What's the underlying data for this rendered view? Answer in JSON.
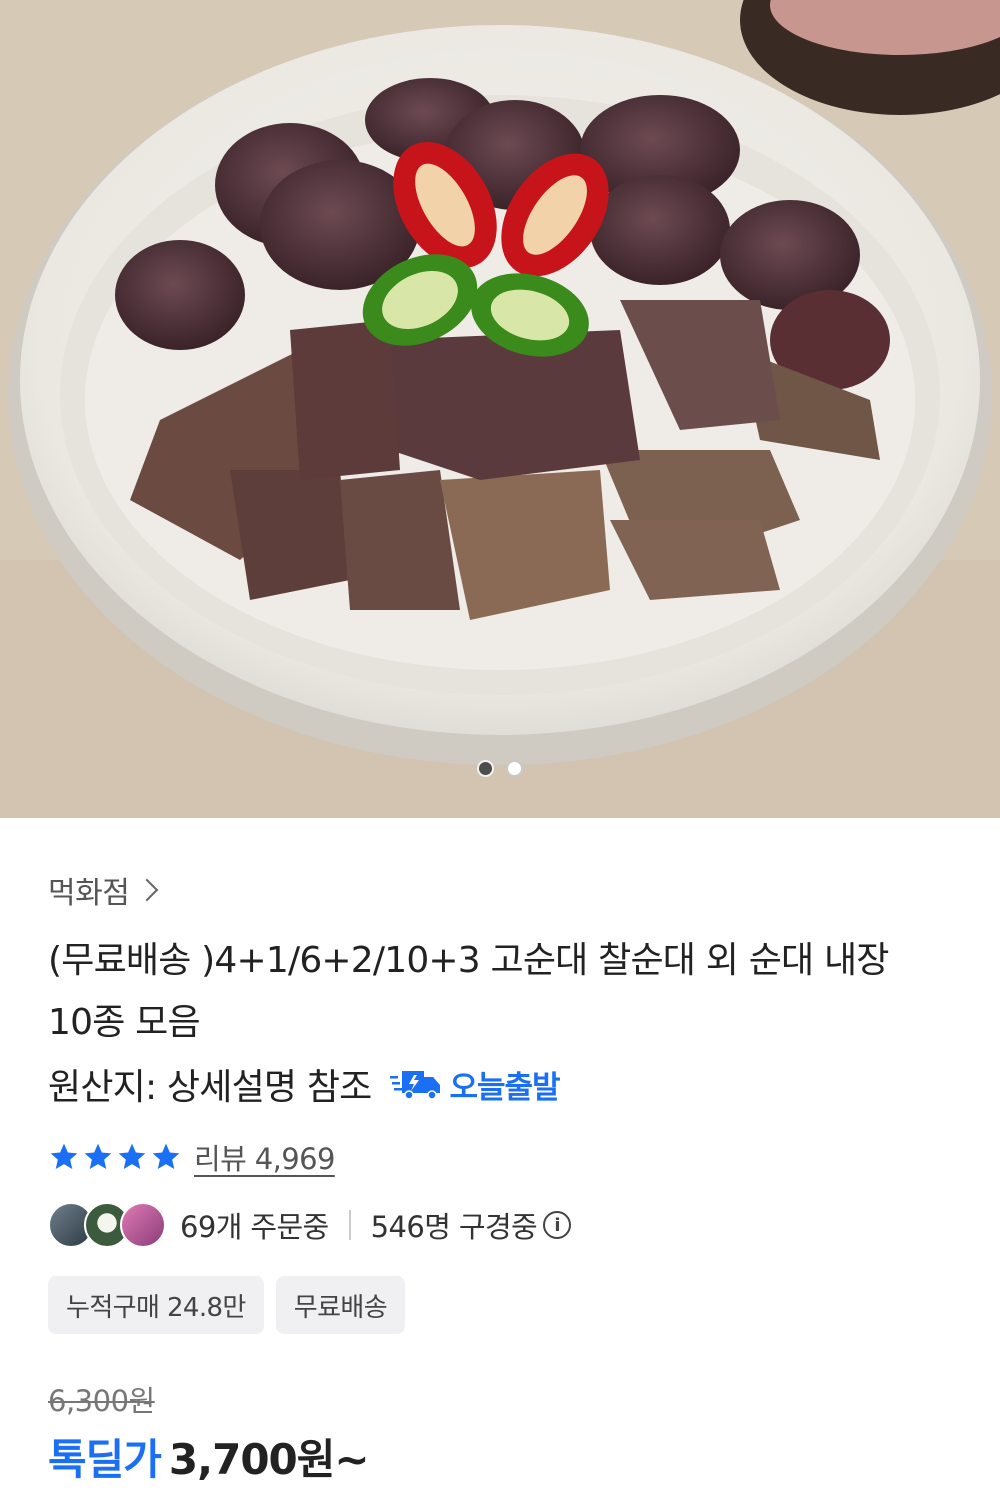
{
  "gallery": {
    "image_alt": "순대 내장 모음 접시",
    "dots": [
      "active",
      "inactive"
    ]
  },
  "seller": {
    "name": "먹화점",
    "chevron_icon": "chevron-right-icon"
  },
  "product": {
    "title": "(무료배송 )4+1/6+2/10+3 고순대 찰순대 외 순대 내장 10종 모음",
    "origin": "원산지: 상세설명 참조",
    "today_badge": "오늘출발"
  },
  "rating": {
    "stars": 4,
    "max": 4,
    "review_label": "리뷰 4,969"
  },
  "social": {
    "ordering": "69개 주문중",
    "viewing": "546명 구경중",
    "info_icon": "i"
  },
  "chips": [
    "누적구매 24.8만",
    "무료배송"
  ],
  "price": {
    "original": "6,300원",
    "deal_label": "톡딜가",
    "deal_price": "3,700원~"
  },
  "colors": {
    "accent": "#1b6ff5",
    "star": "#1b6ff5"
  }
}
